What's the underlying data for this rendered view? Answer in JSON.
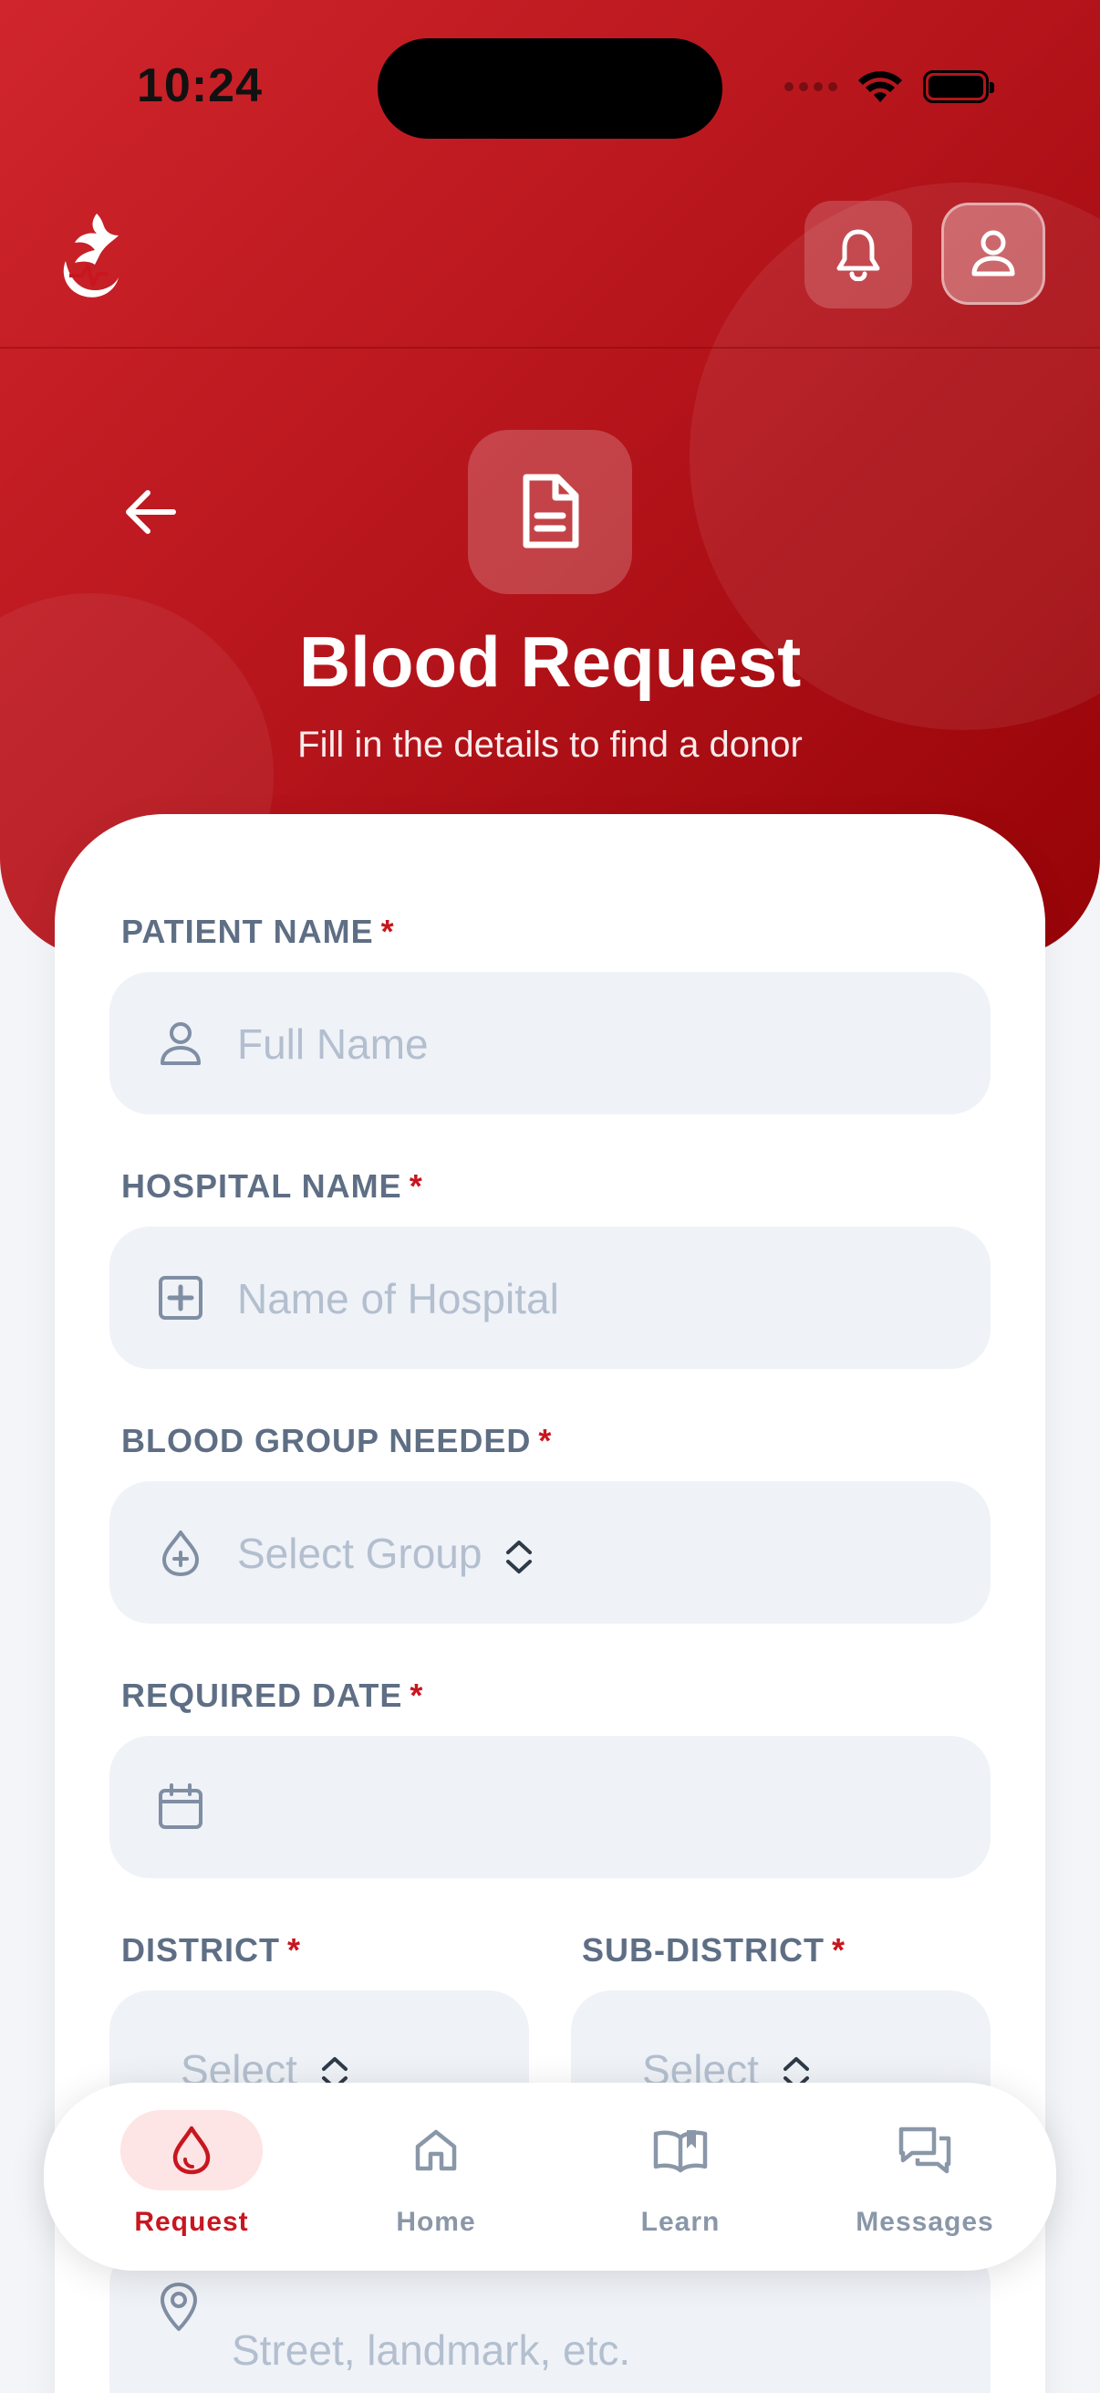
{
  "status_bar": {
    "time": "10:24"
  },
  "header": {
    "logo_icon": "dove-heartbeat-icon",
    "notifications_icon": "bell-icon",
    "profile_icon": "user-icon"
  },
  "page": {
    "title": "Blood Request",
    "subtitle": "Fill in the details to find a donor",
    "back_icon": "arrow-left-icon",
    "header_icon": "document-icon"
  },
  "form": {
    "required_marker": "*",
    "patient_name": {
      "label": "PATIENT NAME",
      "placeholder": "Full Name",
      "icon": "user-icon"
    },
    "hospital_name": {
      "label": "HOSPITAL NAME",
      "placeholder": "Name of Hospital",
      "icon": "plus-square-icon"
    },
    "blood_group": {
      "label": "BLOOD GROUP NEEDED",
      "placeholder": "Select Group",
      "icon": "blood-drop-plus-icon"
    },
    "required_date": {
      "label": "REQUIRED DATE",
      "value": "",
      "icon": "calendar-icon"
    },
    "district": {
      "label": "DISTRICT",
      "placeholder": "Select"
    },
    "sub_district": {
      "label": "SUB-DISTRICT",
      "placeholder": "Select"
    },
    "address": {
      "placeholder": "Street, landmark, etc.",
      "icon": "location-pin-icon"
    }
  },
  "tabs": [
    {
      "label": "Request",
      "icon": "blood-drop-icon",
      "active": true
    },
    {
      "label": "Home",
      "icon": "home-icon",
      "active": false
    },
    {
      "label": "Learn",
      "icon": "book-open-icon",
      "active": false
    },
    {
      "label": "Messages",
      "icon": "chat-bubbles-icon",
      "active": false
    }
  ],
  "colors": {
    "brand_red": "#c8161f",
    "field_bg": "#eff2f7",
    "label_gray": "#5e6e84"
  }
}
